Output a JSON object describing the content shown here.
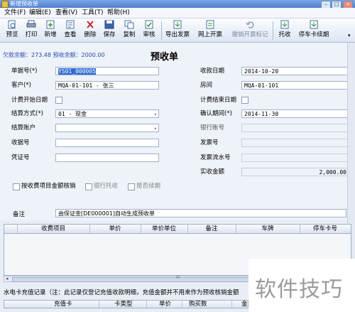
{
  "window": {
    "title": "新增预收单",
    "controls": [
      "–",
      "□",
      "×"
    ]
  },
  "menu": [
    "文件(F)",
    "编辑(E)",
    "查看(V)",
    "工具(T)",
    "帮助(H)"
  ],
  "toolbar": [
    {
      "label": "预览",
      "icon": "preview-icon"
    },
    {
      "label": "打印",
      "icon": "print-icon"
    },
    {
      "label": "新增",
      "icon": "new-icon"
    },
    {
      "label": "查看",
      "icon": "view-icon"
    },
    {
      "label": "删除",
      "icon": "delete-icon"
    },
    {
      "label": "保存",
      "icon": "save-icon"
    },
    {
      "label": "复制",
      "icon": "copy-icon"
    },
    {
      "label": "审核",
      "icon": "audit-icon"
    },
    {
      "label": "导出发票",
      "icon": "export-invoice-icon"
    },
    {
      "label": "网上开票",
      "icon": "online-invoice-icon"
    },
    {
      "label": "撤销开票标记",
      "icon": "undo-invoice-icon"
    },
    {
      "label": "托收",
      "icon": "collection-icon"
    },
    {
      "label": "停车卡续期",
      "icon": "parking-renew-icon"
    }
  ],
  "balance": "欠款余额：273.48 预收余额：2000.00",
  "form": {
    "title": "预收单",
    "doc_no_label": "单据号(*)",
    "doc_no": "YS01_000005",
    "date_label": "收款日期",
    "date": "2014-10-20",
    "customer_label": "客户(*)",
    "customer": "MQA-01-101 - 张三",
    "room_label": "房间",
    "room": "MQA-01-101",
    "bill_start_label": "计费开始日期",
    "bill_end_label": "计费结束日期",
    "method_label": "结算方式(*)",
    "method": "01 - 现金",
    "confirm_label": "确认期间(*)",
    "confirm": "2014-11-30",
    "account_label": "结算账户",
    "bank_label": "银行账号",
    "receipt_label": "收据号",
    "invoice_label": "发票号",
    "voucher_label": "凭证号",
    "invoice_serial_label": "发票流水号",
    "amount_label": "实收金额",
    "amount": "2,000.00",
    "check1": "按收费项目金额核销",
    "check2": "银行托收",
    "check3": "是否续期",
    "remark_label": "备注",
    "remark": "由保证金[DE000001]自动生成预收单"
  },
  "grid_columns": [
    "收费项目",
    "单价",
    "单价单位",
    "备注",
    "车牌",
    "停车卡号"
  ],
  "scroll_mark": "III",
  "sub_title": "水电卡充值记录（注：此记录仅登记充值收款明细，充值金额并不用来作为预收核销金额",
  "sub_columns": [
    "充值卡",
    "卡类型",
    "单价",
    "购买数",
    "金"
  ],
  "watermark": "软件技巧"
}
